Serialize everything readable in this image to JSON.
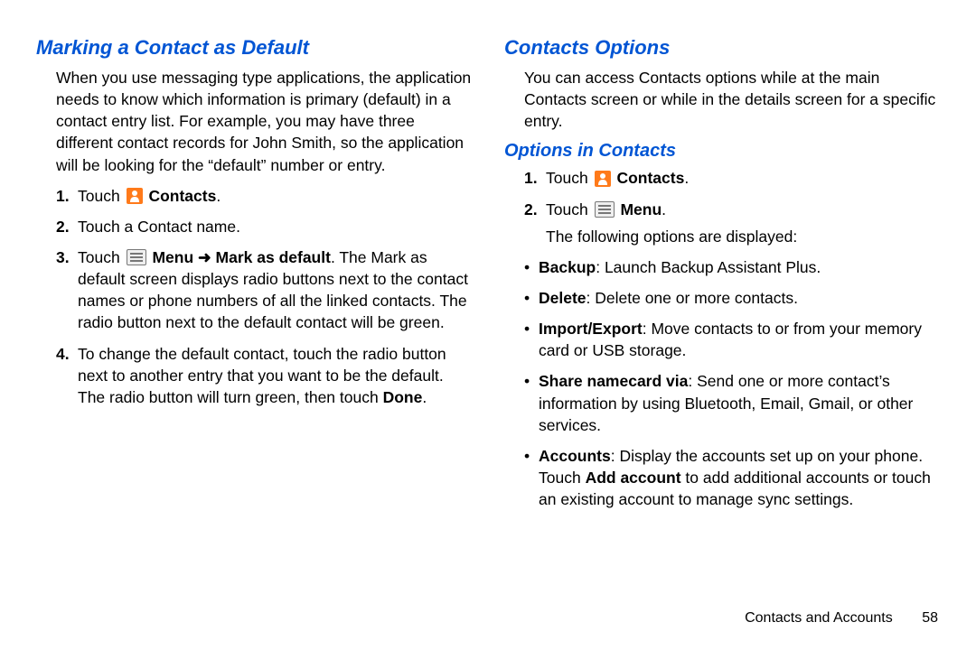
{
  "left": {
    "heading": "Marking a Contact as Default",
    "intro": "When you use messaging type applications, the application needs to know which information is primary (default) in a contact entry list. For example, you may have three different contact records for John Smith, so the application will be looking for the “default” number or entry.",
    "steps": {
      "s1_touch": "Touch ",
      "s1_contacts": "Contacts",
      "s1_end": ".",
      "s2": "Touch a Contact name.",
      "s3_a": "Touch ",
      "s3_menu": "Menu",
      "s3_arrow": " ➜ ",
      "s3_mark": "Mark as default",
      "s3_b": ". The Mark as default screen displays radio buttons next to the contact names or phone numbers of all the linked contacts. The radio button next to the default contact will be green.",
      "s4_a": "To change the default contact, touch the radio button next to another entry that you want to be the default. The radio button will turn green, then touch ",
      "s4_done": "Done",
      "s4_b": "."
    }
  },
  "right": {
    "heading": "Contacts Options",
    "intro": "You can access Contacts options while at the main Contacts screen or while in the details screen for a specific entry.",
    "sub": "Options in Contacts",
    "steps": {
      "s1_touch": "Touch ",
      "s1_contacts": "Contacts",
      "s1_end": ".",
      "s2_touch": "Touch ",
      "s2_menu": "Menu",
      "s2_end": ".",
      "s2_follow": "The following options are displayed:"
    },
    "bullets": {
      "b1_k": "Backup",
      "b1_v": ": Launch Backup Assistant Plus.",
      "b2_k": "Delete",
      "b2_v": ": Delete one or more contacts.",
      "b3_k": "Import/Export",
      "b3_v": ": Move contacts to or from your memory card or USB storage.",
      "b4_k": "Share namecard via",
      "b4_v": ": Send one or more contact’s information by using Bluetooth, Email, Gmail, or other services.",
      "b5_k": "Accounts",
      "b5_va": ": Display the accounts set up on your phone. Touch ",
      "b5_add": "Add account",
      "b5_vb": " to add additional accounts or touch an existing account to manage sync settings."
    }
  },
  "footer": {
    "section": "Contacts and Accounts",
    "page": "58"
  },
  "nums": {
    "n1": "1.",
    "n2": "2.",
    "n3": "3.",
    "n4": "4."
  }
}
